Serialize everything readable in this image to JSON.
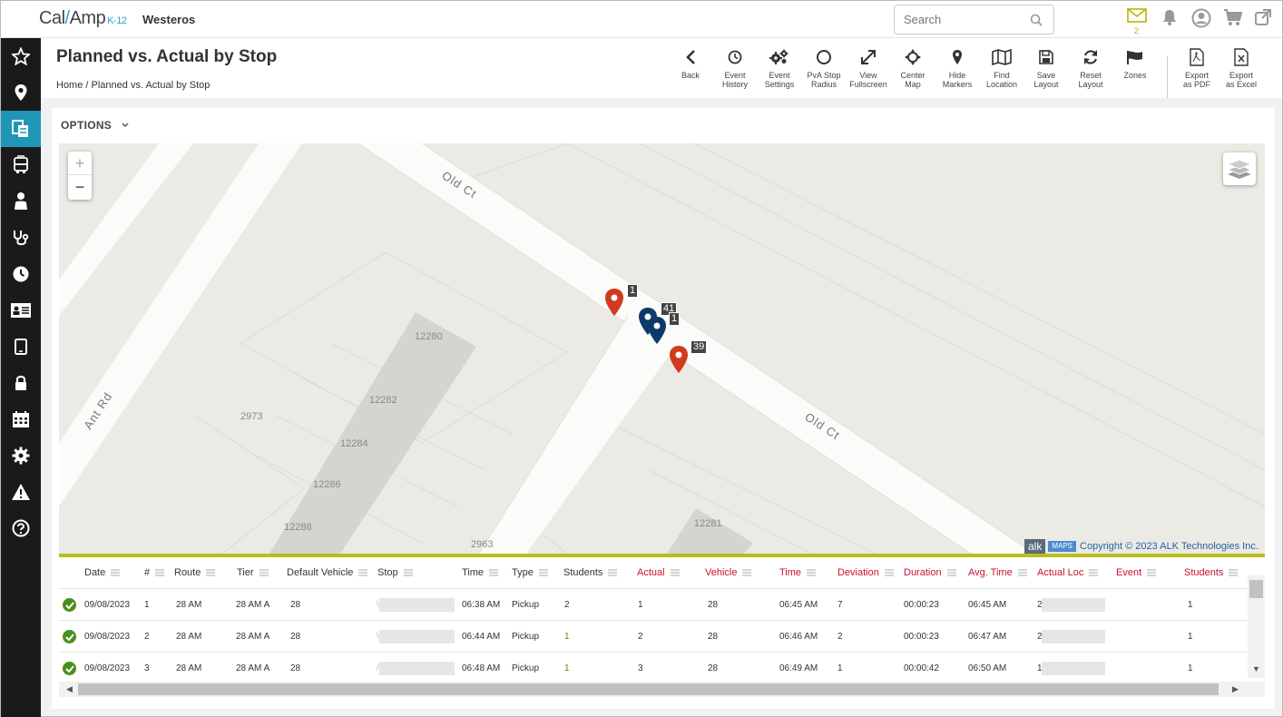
{
  "app": {
    "logo_main": "Cal",
    "logo_slash": "/",
    "logo_rest": "Amp",
    "logo_sub": "K-12",
    "org_name": "Westeros"
  },
  "search": {
    "placeholder": "Search"
  },
  "top_icons": {
    "mail_badge": "2"
  },
  "page": {
    "title": "Planned vs. Actual by Stop",
    "breadcrumb_home": "Home",
    "breadcrumb_sep": "/",
    "breadcrumb_current": "Planned vs. Actual by Stop"
  },
  "toolbar": [
    {
      "line1": "Back",
      "line2": ""
    },
    {
      "line1": "Event",
      "line2": "History"
    },
    {
      "line1": "Event",
      "line2": "Settings"
    },
    {
      "line1": "PvA Stop",
      "line2": "Radius"
    },
    {
      "line1": "View",
      "line2": "Fullscreen"
    },
    {
      "line1": "Center",
      "line2": "Map"
    },
    {
      "line1": "Hide",
      "line2": "Markers"
    },
    {
      "line1": "Find",
      "line2": "Location"
    },
    {
      "line1": "Save",
      "line2": "Layout"
    },
    {
      "line1": "Reset",
      "line2": "Layout"
    },
    {
      "line1": "Zones",
      "line2": ""
    },
    {
      "line1": "Export",
      "line2": "as PDF"
    },
    {
      "line1": "Export",
      "line2": "as Excel"
    }
  ],
  "options": {
    "label": "OPTIONS"
  },
  "map": {
    "zoom_in": "+",
    "zoom_out": "−",
    "street_labels": [
      "Old Ct",
      "Old Ct",
      "Ant Rd"
    ],
    "parcel_numbers": [
      "12280",
      "12282",
      "12284",
      "12286",
      "12288",
      "2973",
      "2963",
      "12281"
    ],
    "markers": [
      "1",
      "41",
      "1",
      "39"
    ],
    "alk_logo": "alk",
    "maps_logo": "MAPS",
    "copyright": "Copyright © 2023 ALK Technologies Inc."
  },
  "table": {
    "headers": [
      "Date",
      "#",
      "Route",
      "Tier",
      "Default Vehicle",
      "Stop",
      "Time",
      "Type",
      "Students",
      "Actual",
      "Vehicle",
      "Time",
      "Deviation",
      "Duration",
      "Avg. Time",
      "Actual Loc",
      "Event",
      "Students"
    ],
    "rows": [
      {
        "date": "09/08/2023",
        "num": "1",
        "route": "28 AM",
        "tier": "28 AM  A",
        "vehicle": "28",
        "stop": "\\",
        "time": "06:38 AM",
        "type": "Pickup",
        "students": "2",
        "actual": "1",
        "act_vehicle": "28",
        "act_time": "06:45 AM",
        "deviation": "7",
        "duration": "00:00:23",
        "avg_time": "06:45 AM",
        "actual_loc": "2",
        "event": "",
        "act_students": "1"
      },
      {
        "date": "09/08/2023",
        "num": "2",
        "route": "28 AM",
        "tier": "28 AM  A",
        "vehicle": "28",
        "stop": "\\",
        "time": "06:44 AM",
        "type": "Pickup",
        "students": "1",
        "actual": "2",
        "act_vehicle": "28",
        "act_time": "06:46 AM",
        "deviation": "2",
        "duration": "00:00:23",
        "avg_time": "06:47 AM",
        "actual_loc": "2",
        "event": "",
        "act_students": "1"
      },
      {
        "date": "09/08/2023",
        "num": "3",
        "route": "28 AM",
        "tier": "28 AM  A",
        "vehicle": "28",
        "stop": "/",
        "time": "06:48 AM",
        "type": "Pickup",
        "students": "1",
        "actual": "3",
        "act_vehicle": "28",
        "act_time": "06:49 AM",
        "deviation": "1",
        "duration": "00:00:42",
        "avg_time": "06:50 AM",
        "actual_loc": "1",
        "event": "",
        "act_students": "1"
      }
    ]
  },
  "colors": {
    "accent": "#1f96b8",
    "sidebar": "#1a1a1a",
    "pin_planned": "#d23a1e",
    "pin_actual": "#0d3a6b",
    "status_ok": "#4a8f1d",
    "highlight_red": "#c8102e",
    "map_divider": "#b9bd1e"
  }
}
